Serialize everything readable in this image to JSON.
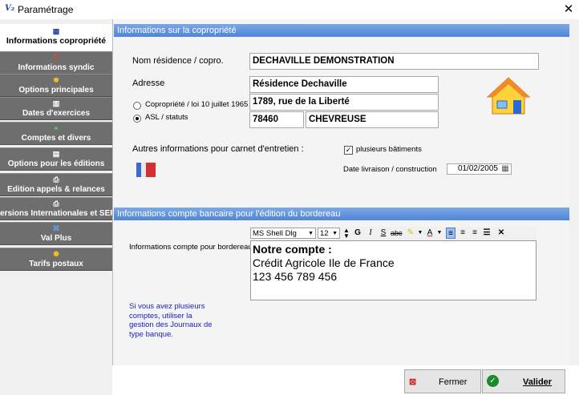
{
  "window": {
    "title": "Paramétrage",
    "close_glyph": "✕",
    "app_icon": "V₂"
  },
  "sidebar": {
    "items": [
      {
        "label": "Informations copropriété",
        "icon": "grid-icon",
        "glyph": "▦",
        "active": true
      },
      {
        "label": "Informations syndic",
        "icon": "info-icon",
        "glyph": "❓",
        "active": false
      },
      {
        "label": "Options principales",
        "icon": "gear-icon",
        "glyph": "✹",
        "active": false
      },
      {
        "label": "Dates d'exercices",
        "icon": "calendar-icon",
        "glyph": "▥",
        "active": false
      },
      {
        "label": "Comptes et divers",
        "icon": "accounts-icon",
        "glyph": "⚭",
        "active": false
      },
      {
        "label": "Options pour les éditions",
        "icon": "document-icon",
        "glyph": "▤",
        "active": false
      },
      {
        "label": "Edition appels & relances",
        "icon": "print-icon",
        "glyph": "⎙",
        "active": false
      },
      {
        "label": "ersions Internationales et SEF",
        "icon": "print-icon",
        "glyph": "⎙",
        "active": false
      },
      {
        "label": "Val Plus",
        "icon": "network-icon",
        "glyph": "⌘",
        "active": false
      },
      {
        "label": "Tarifs postaux",
        "icon": "stamp-icon",
        "glyph": "✺",
        "active": false
      }
    ]
  },
  "section1": {
    "header": "Informations sur la copropriété",
    "name_label": "Nom résidence / copro.",
    "name_value": "DECHAVILLE DEMONSTRATION",
    "address_label": "Adresse",
    "address_line1": "Résidence Dechaville",
    "address_line2": "1789, rue de la Liberté",
    "postal_code": "78460",
    "city": "CHEVREUSE",
    "radio1_label": "Copropriété / loi 10 juillet 1965",
    "radio2_label": "ASL / statuts",
    "other_info_label": "Autres informations pour carnet d'entretien :",
    "multi_buildings_label": "plusieurs bâtiments",
    "delivery_date_label": "Date livraison / construction",
    "delivery_date_value": "01/02/2005"
  },
  "section2": {
    "header": "Informations compte bancaire pour l'édition du bordereau",
    "account_label": "Informations compte pour bordereau",
    "font_name": "MS Shell Dlg",
    "font_size": "12",
    "editor_lines": [
      "Notre compte :",
      "Crédit Agricole Ile de France",
      "123 456 789 456"
    ],
    "help_text": "Si vous avez plusieurs comptes, utiliser la gestion des Journaux de type banque."
  },
  "buttons": {
    "cancel": "Fermer",
    "ok": "Valider"
  },
  "colors": {
    "section_header": "#5b8fdc",
    "sidebar_item": "#6e6e6e",
    "help_text": "#2020c0"
  }
}
